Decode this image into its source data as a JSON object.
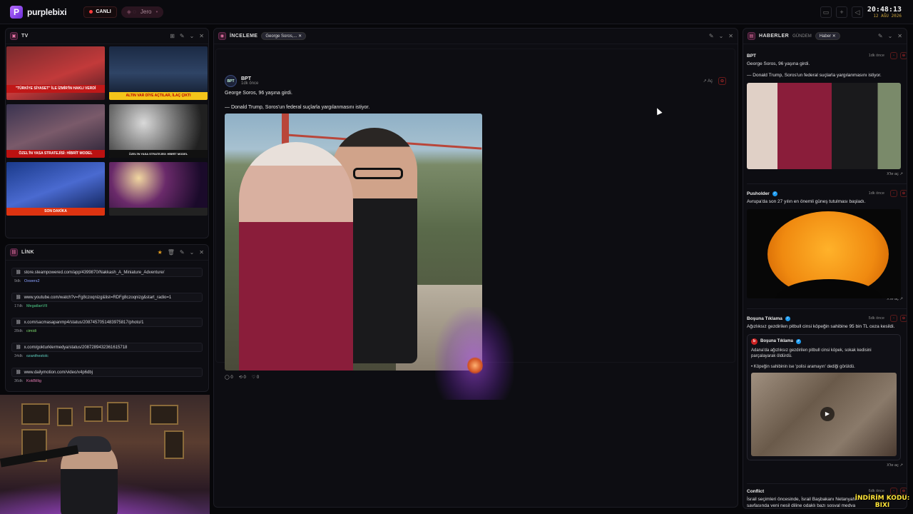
{
  "topbar": {
    "logo_mark": "P",
    "logo_text": "purplebixi",
    "live_label": "CANLI",
    "user_label": "Jero",
    "time": "20:48:13",
    "date": "12 AĞU 2026"
  },
  "tv_panel": {
    "title": "TV",
    "thumbnails": [
      {
        "caption": "\"TÜRKİYE SİYASET\" İLE İZMİR'İN HAKLI VERDİ"
      },
      {
        "caption": "ALTIN VAR DİYE AÇTILAR, İLAÇ ÇIKTI"
      },
      {
        "caption": "ÖZEL'İN YASA STRATEJİSİ: HİBRİT MODEL"
      },
      {
        "caption": "ÖZEL'İN YASA STRATEJİSİ: HİBRİT MODEL"
      },
      {
        "caption": "SON DAKİKA"
      },
      {
        "caption": ""
      }
    ]
  },
  "link_panel": {
    "title": "LİNK",
    "items": [
      {
        "url": "store.steampowered.com/app/4399870/Nakkash_A_Miniature_Adventure/",
        "time": "9dk",
        "user": "Oxwers2",
        "user_color": "#8aa0ff"
      },
      {
        "url": "www.youtube.com/watch?v=Fg8czoqnizg&list=RDFg8czoqnizg&start_radio=1",
        "time": "17dk",
        "user": "MegatlanVII",
        "user_color": "#4fd18b"
      },
      {
        "url": "x.com/sacmasapanmp4/status/2087457051483975817/photo/1",
        "time": "28dk",
        "user": "cimidi",
        "user_color": "#7bd96b"
      },
      {
        "url": "x.com/gokturklermedya/status/2087289432361615718",
        "time": "34dk",
        "user": "ozanthestolc",
        "user_color": "#5fd0c0"
      },
      {
        "url": "www.dailymotion.com/video/x4p6dbj",
        "time": "36dk",
        "user": "KokBillig",
        "user_color": "#e07ab0"
      }
    ]
  },
  "center_panel": {
    "title": "İNCELEME",
    "tag": "George Soros,...",
    "post": {
      "avatar": "BPT",
      "author": "BPT",
      "time": "1dk önce",
      "open_label": "Aç",
      "line1": "George Soros, 96 yaşına girdi.",
      "line2": "— Donald Trump, Soros'un federal suçlarla yargılanmasını istiyor.",
      "replies": "0",
      "reposts": "0",
      "likes": "0"
    }
  },
  "news_panel": {
    "title": "HABERLER",
    "tab_muted": "GÜNDEM",
    "tab_active": "Haber",
    "items": [
      {
        "author": "BPT",
        "time": "1dk önce",
        "text1": "George Soros, 96 yaşına girdi.",
        "text2": "— Donald Trump, Soros'un federal suçlarla yargılanmasını istiyor.",
        "open": "X'te aç"
      },
      {
        "author": "Pusholder",
        "time": "1dk önce",
        "text1": "Avrupa'da son 27 yılın en önemli güneş tutulması başladı.",
        "open": "X'te aç"
      },
      {
        "author": "Boşuna Tıklama",
        "time": "5dk önce",
        "text1": "Ağızlıksız gezdirilen pitbull cinsi köpeğin sahibine 95 bin TL ceza kesildi.",
        "quote_author": "Boşuna Tıklama",
        "quote_text1": "Adana'da ağızlıksız gezdirilen pitbull cinsi köpek, sokak kedisini parçalayarak öldürdü.",
        "quote_text2": "• Köpeğin sahibinin ise 'polisi aramayın' dediği görüldü.",
        "open": "X'te aç"
      },
      {
        "author": "Conflict",
        "time": "6dk önce",
        "text1": "İsrail seçimleri öncesinde, İsrail Başbakanı Netanyahu",
        "text2": "savfasında veni nesil diline odaklı bazı sosval medva"
      }
    ]
  },
  "promo": {
    "line1": "İNDİRİM KODU:",
    "line2": "BIXI"
  }
}
